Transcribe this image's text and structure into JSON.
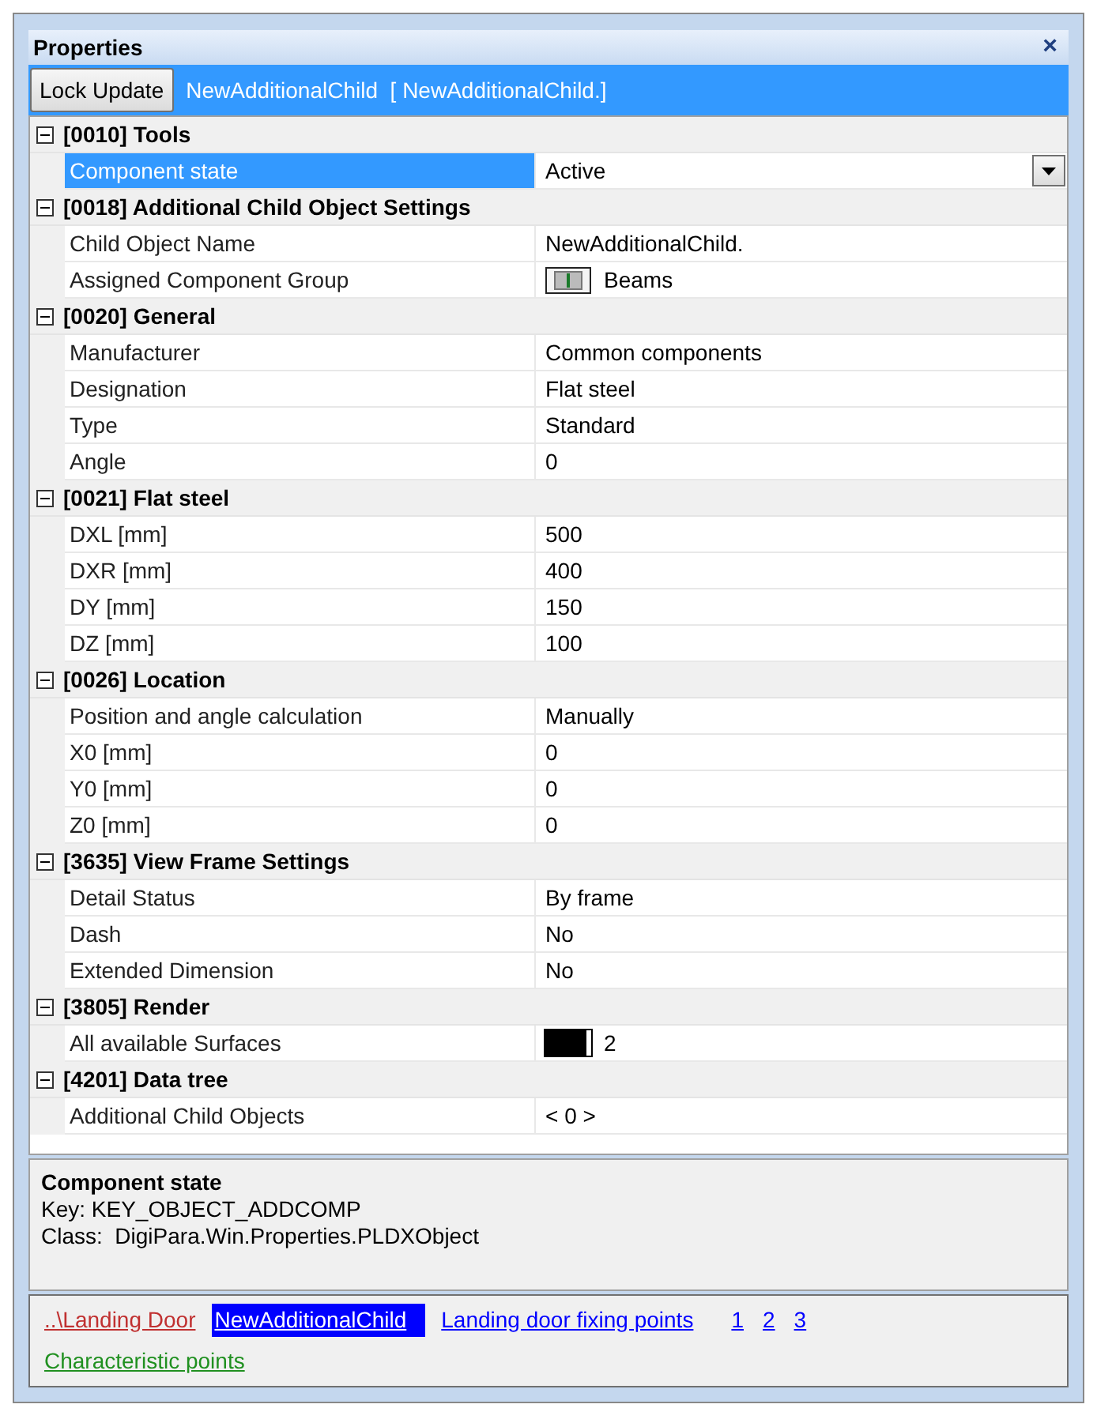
{
  "window": {
    "title": "Properties",
    "close": "×"
  },
  "toolbar": {
    "button": "Lock Update",
    "caption": "NewAdditionalChild  [ NewAdditionalChild.]"
  },
  "groups": [
    {
      "title": "[0010] Tools",
      "expanded": true,
      "properties": [
        {
          "name": "Component state",
          "value": "Active",
          "kind": "dropdown",
          "selected": true
        }
      ]
    },
    {
      "title": "[0018] Additional Child Object Settings",
      "expanded": true,
      "properties": [
        {
          "name": "Child Object Name",
          "value": "NewAdditionalChild.",
          "kind": "text",
          "selected": false
        },
        {
          "name": "Assigned Component Group",
          "value": "Beams",
          "kind": "icon",
          "selected": false
        }
      ]
    },
    {
      "title": "[0020] General",
      "expanded": true,
      "properties": [
        {
          "name": "Manufacturer",
          "value": "Common components",
          "kind": "text",
          "selected": false
        },
        {
          "name": "Designation",
          "value": "Flat steel",
          "kind": "text",
          "selected": false
        },
        {
          "name": "Type",
          "value": "Standard",
          "kind": "text",
          "selected": false
        },
        {
          "name": "Angle",
          "value": "0",
          "kind": "text",
          "selected": false
        }
      ]
    },
    {
      "title": "[0021] Flat steel",
      "expanded": true,
      "properties": [
        {
          "name": "DXL [mm]",
          "value": "500",
          "kind": "text",
          "selected": false
        },
        {
          "name": "DXR [mm]",
          "value": "400",
          "kind": "text",
          "selected": false
        },
        {
          "name": "DY [mm]",
          "value": "150",
          "kind": "text",
          "selected": false
        },
        {
          "name": "DZ [mm]",
          "value": "100",
          "kind": "text",
          "selected": false
        }
      ]
    },
    {
      "title": "[0026] Location",
      "expanded": true,
      "properties": [
        {
          "name": "Position and angle calculation",
          "value": "Manually",
          "kind": "text",
          "selected": false
        },
        {
          "name": "X0 [mm]",
          "value": "0",
          "kind": "text",
          "selected": false
        },
        {
          "name": "Y0 [mm]",
          "value": "0",
          "kind": "text",
          "selected": false
        },
        {
          "name": "Z0 [mm]",
          "value": "0",
          "kind": "text",
          "selected": false
        }
      ]
    },
    {
      "title": "[3635] View Frame Settings",
      "expanded": true,
      "properties": [
        {
          "name": "Detail Status",
          "value": "By frame",
          "kind": "text",
          "selected": false
        },
        {
          "name": "Dash",
          "value": "No",
          "kind": "text",
          "selected": false
        },
        {
          "name": "Extended Dimension",
          "value": "No",
          "kind": "text",
          "selected": false
        }
      ]
    },
    {
      "title": "[3805] Render",
      "expanded": true,
      "properties": [
        {
          "name": "All available Surfaces",
          "value": "2",
          "kind": "swatch",
          "selected": false
        }
      ]
    },
    {
      "title": "[4201] Data tree",
      "expanded": true,
      "properties": [
        {
          "name": "Additional Child Objects",
          "value": "< 0 >",
          "kind": "text",
          "selected": false
        }
      ]
    }
  ],
  "description": {
    "title": "Component state",
    "lines": [
      "Key: KEY_OBJECT_ADDCOMP",
      "Class:  DigiPara.Win.Properties.PLDXObject"
    ]
  },
  "link_rows": [
    [
      {
        "label": "..\\Landing Door",
        "color": "#c03030",
        "selected": false
      },
      {
        "label": "NewAdditionalChild",
        "color": "#0000ff",
        "selected": true
      },
      {
        "label": "Landing door fixing points",
        "color": "#0000ff",
        "selected": false
      },
      {
        "label": "1",
        "color": "#0000ff",
        "selected": false
      },
      {
        "label": "2",
        "color": "#0000ff",
        "selected": false
      },
      {
        "label": "3",
        "color": "#0000ff",
        "selected": false
      }
    ],
    [
      {
        "label": "Characteristic points",
        "color": "#209020",
        "selected": false
      }
    ]
  ]
}
